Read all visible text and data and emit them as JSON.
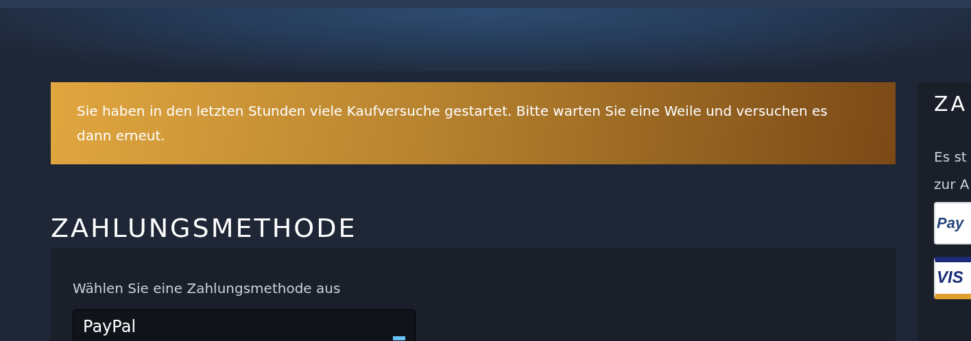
{
  "notice": {
    "text": "Sie haben in den letzten Stunden viele Kaufversuche gestartet. Bitte warten Sie eine Weile und versuchen es dann erneut."
  },
  "payment": {
    "title": "ZAHLUNGSMETHODE",
    "label": "Wählen Sie eine Zahlungsmethode aus",
    "value": "PayPal"
  },
  "sidebar": {
    "title": "ZA",
    "lines": [
      "Es st",
      "zur A"
    ],
    "logos": [
      {
        "kind": "paypal",
        "text": "Pay"
      },
      {
        "kind": "visa",
        "text": "VIS"
      }
    ]
  }
}
